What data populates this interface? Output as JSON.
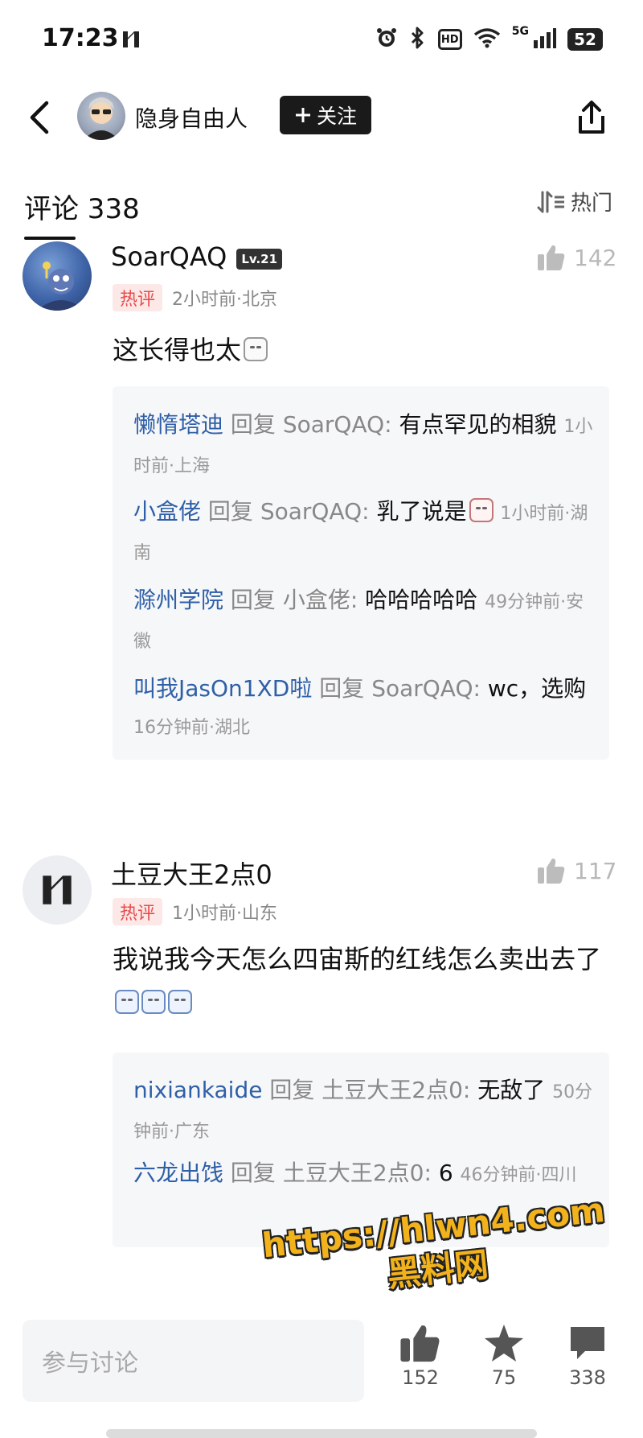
{
  "status_bar": {
    "time": "17:23",
    "network": "5G",
    "hd": "HD",
    "battery": "52"
  },
  "header": {
    "username": "隐身自由人",
    "follow_label": "关注"
  },
  "comments_header": {
    "title": "评论 338",
    "sort_label": "热门"
  },
  "comments": [
    {
      "username": "SoarQAQ",
      "level": "Lv.21",
      "tag": "热评",
      "meta": "2小时前·北京",
      "likes": "142",
      "text": "这长得也太",
      "replies": [
        {
          "name": "懒惰塔迪",
          "reply_word": "回复",
          "target": "SoarQAQ:",
          "text": " 有点罕见的相貌",
          "meta": "1小时前·上海"
        },
        {
          "name": "小盒佬",
          "reply_word": "回复",
          "target": "SoarQAQ:",
          "text": " 乳了说是",
          "meta": "1小时前·湖南"
        },
        {
          "name": "滁州学院",
          "reply_word": "回复",
          "target": "小盒佬:",
          "text": " 哈哈哈哈哈",
          "meta": "49分钟前·安徽"
        },
        {
          "name": "叫我JasOn1XD啦",
          "reply_word": "回复",
          "target": "SoarQAQ:",
          "text": " wc，选购",
          "meta": "16分钟前·湖北"
        }
      ]
    },
    {
      "username": "土豆大王2点0",
      "tag": "热评",
      "meta": "1小时前·山东",
      "likes": "117",
      "text": "我说我今天怎么四宙斯的红线怎么卖出去了",
      "replies": [
        {
          "name": "nixiankaide",
          "reply_word": "回复",
          "target": "土豆大王2点0:",
          "text": " 无敌了",
          "meta": "50分钟前·广东"
        },
        {
          "name": "六龙出饯",
          "reply_word": "回复",
          "target": "土豆大王2点0:",
          "text": " 6",
          "meta": "46分钟前·四川"
        }
      ]
    }
  ],
  "bottom_bar": {
    "input_placeholder": "参与讨论",
    "likes": "152",
    "favorites": "75",
    "comments": "338"
  },
  "watermark": {
    "line1": "https://hlwn4.com",
    "line2": "黑料网"
  }
}
